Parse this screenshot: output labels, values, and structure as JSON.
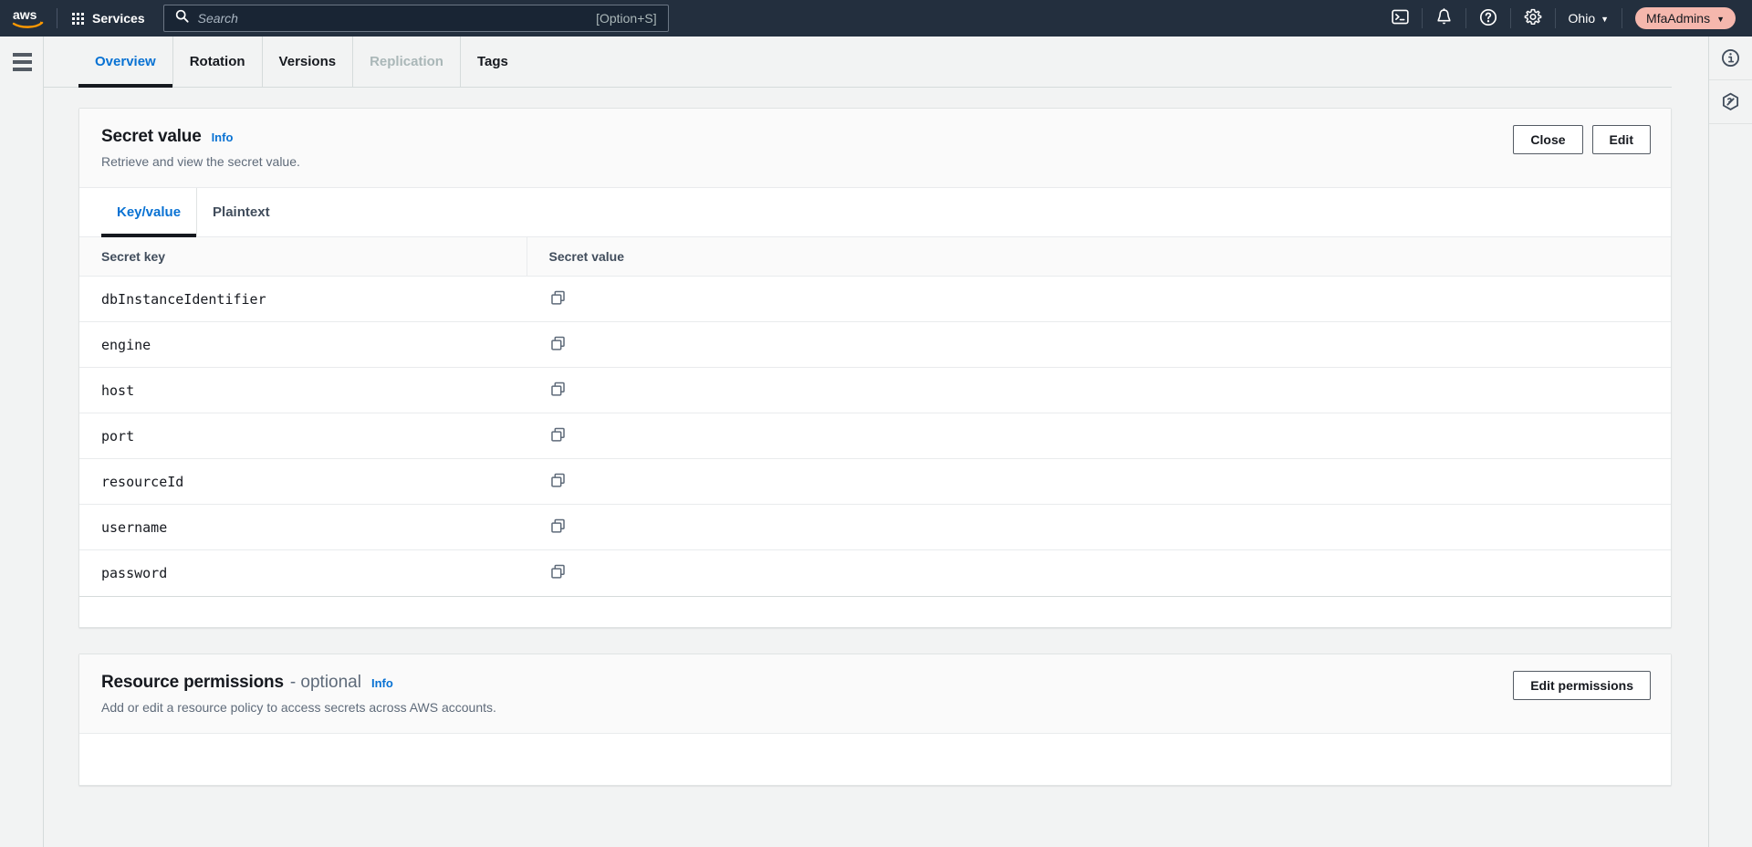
{
  "topnav": {
    "logo_name": "aws-logo",
    "services_label": "Services",
    "search": {
      "placeholder": "Search",
      "value": "",
      "shortcut": "[Option+S]"
    },
    "icons": [
      {
        "name": "cloudshell-icon",
        "title": "CloudShell"
      },
      {
        "name": "notifications-bell-icon",
        "title": "Notifications"
      },
      {
        "name": "help-question-icon",
        "title": "Help"
      },
      {
        "name": "settings-gear-icon",
        "title": "Settings"
      }
    ],
    "region_label": "Ohio",
    "account_label": "MfaAdmins",
    "colors": {
      "bar_bg": "#232f3e",
      "search_bg": "#192534",
      "account_pill_bg": "#f5b7ad",
      "logo_orange": "#ff9900"
    }
  },
  "left_rail": {
    "menu_icon": "hamburger-menu-icon"
  },
  "right_rail": {
    "items": [
      {
        "name": "info-panel-icon"
      },
      {
        "name": "shortcut-panel-icon"
      }
    ]
  },
  "tabs": [
    {
      "label": "Overview",
      "active": true,
      "disabled": false
    },
    {
      "label": "Rotation",
      "active": false,
      "disabled": false
    },
    {
      "label": "Versions",
      "active": false,
      "disabled": false
    },
    {
      "label": "Replication",
      "active": false,
      "disabled": true
    },
    {
      "label": "Tags",
      "active": false,
      "disabled": false
    }
  ],
  "secret_value_panel": {
    "title": "Secret value",
    "info_label": "Info",
    "description": "Retrieve and view the secret value.",
    "close_label": "Close",
    "edit_label": "Edit",
    "subtabs": [
      {
        "label": "Key/value",
        "active": true
      },
      {
        "label": "Plaintext",
        "active": false
      }
    ],
    "table": {
      "columns": [
        "Secret key",
        "Secret value"
      ],
      "rows": [
        {
          "key": "dbInstanceIdentifier",
          "value": "",
          "copy_icon": "copy-icon"
        },
        {
          "key": "engine",
          "value": "",
          "copy_icon": "copy-icon"
        },
        {
          "key": "host",
          "value": "",
          "copy_icon": "copy-icon"
        },
        {
          "key": "port",
          "value": "",
          "copy_icon": "copy-icon"
        },
        {
          "key": "resourceId",
          "value": "",
          "copy_icon": "copy-icon"
        },
        {
          "key": "username",
          "value": "",
          "copy_icon": "copy-icon"
        },
        {
          "key": "password",
          "value": "",
          "copy_icon": "copy-icon"
        }
      ]
    }
  },
  "resource_permissions_panel": {
    "title": "Resource permissions",
    "optional_suffix": "- optional",
    "info_label": "Info",
    "description": "Add or edit a resource policy to access secrets across AWS accounts.",
    "edit_permissions_label": "Edit permissions"
  },
  "accent_colors": {
    "link_blue": "#0972d3",
    "text_dark": "#16191f",
    "text_muted": "#5f6b7a",
    "border": "#e0e3e3",
    "page_bg": "#f2f3f3"
  }
}
